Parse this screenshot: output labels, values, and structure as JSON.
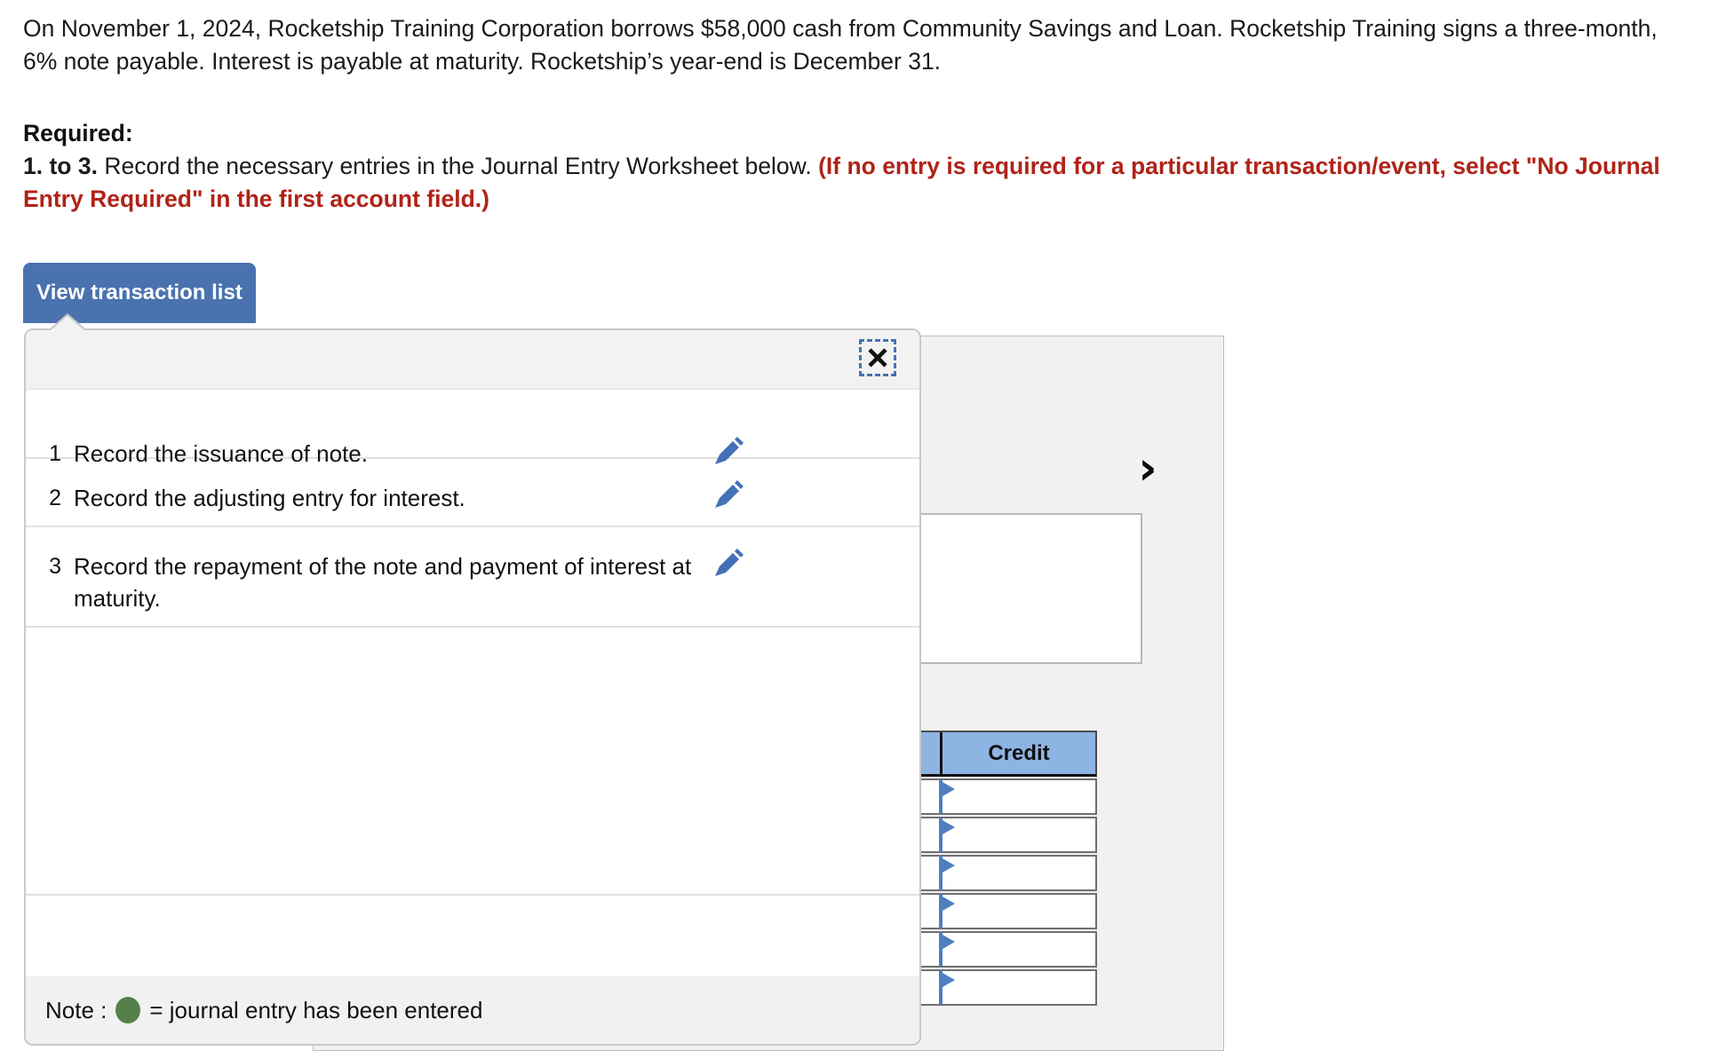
{
  "problem": {
    "statement": "On November 1, 2024, Rocketship Training Corporation borrows $58,000 cash from Community Savings and Loan. Rocketship Training signs a three-month, 6% note payable. Interest is payable at maturity. Rocketship’s year-end is December 31.",
    "required_label": "Required:",
    "required_prefix": "1. to 3.",
    "required_text": " Record the necessary entries in the Journal Entry Worksheet below. ",
    "required_red": "(If no entry is required for a particular transaction/event, select \"No Journal Entry Required\" in the first account field.)"
  },
  "tab": {
    "view_transaction_list_label": "View transaction list"
  },
  "transaction_popup": {
    "close_icon": "close-x-icon",
    "edit_icon": "pencil-edit-icon",
    "rows": [
      {
        "num": "1",
        "description": "Record the issuance of note."
      },
      {
        "num": "2",
        "description": "Record the adjusting entry for interest."
      },
      {
        "num": "3",
        "description": "Record the repayment of the note and payment of interest at maturity."
      }
    ],
    "note": {
      "prefix": "Note :",
      "suffix": "= journal entry has been entered",
      "dot_color": "#55804a"
    }
  },
  "worksheet": {
    "next_icon": "chevron-right-icon",
    "table": {
      "columns": [
        "",
        "Credit"
      ],
      "row_count": 6,
      "row_values": [
        "",
        "",
        "",
        "",
        "",
        ""
      ],
      "header_color": "#8db4e2"
    }
  },
  "colors": {
    "tab_blue": "#4a72ae",
    "accent_blue": "#4471b5",
    "warning_red": "#b02318",
    "panel_gray": "#f1f1f1",
    "green_dot": "#55804a"
  }
}
